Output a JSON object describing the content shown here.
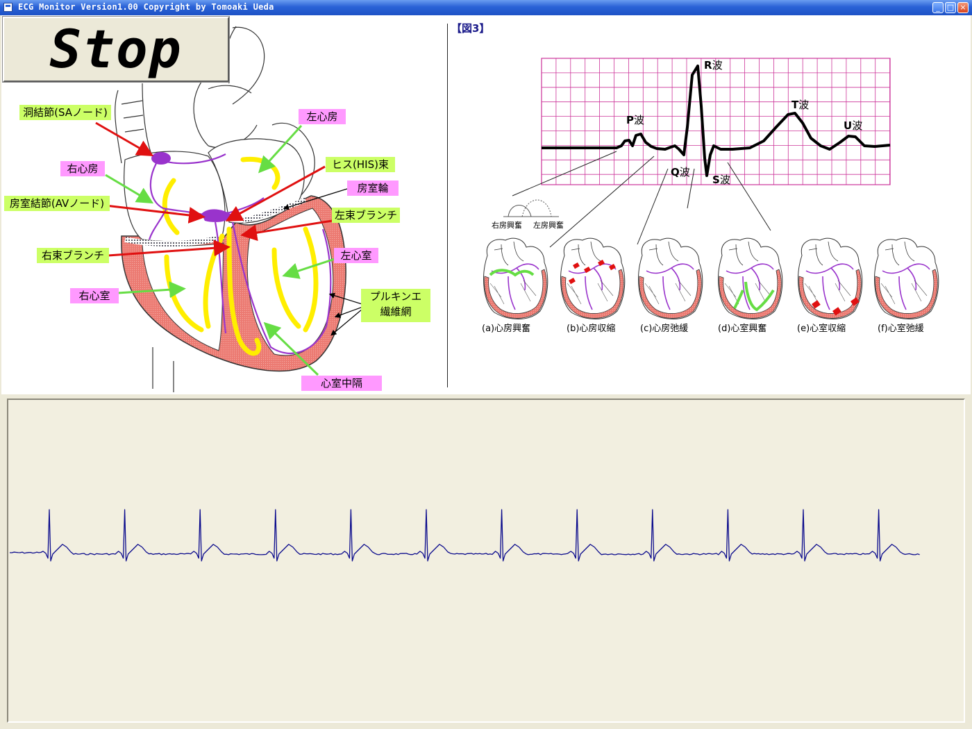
{
  "window": {
    "title": "ECG Monitor Version1.00 Copyright by Tomoaki Ueda",
    "buttons": {
      "minimize": "_",
      "maximize": "□",
      "close": "×"
    }
  },
  "control": {
    "stop_label": "Stop"
  },
  "heart_diagram": {
    "labels": {
      "sa_node": "洞結節(SAノード)",
      "right_atrium": "右心房",
      "av_node": "房室結節(AVノード)",
      "right_bundle": "右束ブランチ",
      "right_ventricle": "右心室",
      "left_atrium": "左心房",
      "his_bundle": "ヒス(HIS)束",
      "av_ring": "房室輪",
      "left_bundle": "左束ブランチ",
      "left_ventricle": "左心室",
      "purkinje_1": "プルキンエ",
      "purkinje_2": "繊維網",
      "septum": "心室中隔"
    }
  },
  "figure3": {
    "title": "【図3】",
    "waves": {
      "p": "P",
      "q": "Q",
      "r": "R",
      "s": "S",
      "t": "T",
      "u": "U",
      "suffix": "波"
    },
    "atrial_labels": {
      "right": "右房興奮",
      "left": "左房興奮"
    },
    "phases": [
      "(a)心房興奮",
      "(b)心房収縮",
      "(c)心房弛緩",
      "(d)心室興奮",
      "(e)心室収縮",
      "(f)心室弛緩"
    ]
  },
  "monitor": {
    "trace_color": "#0a0a8c",
    "beat_count": 12
  },
  "colors": {
    "grid": "#cc3399",
    "label_green": "#ccff66",
    "label_pink": "#ff99ff",
    "arrow_red": "#e01010",
    "arrow_green": "#66dd44",
    "conduction_purple": "#9933cc",
    "myocardium": "#e86a6a"
  }
}
